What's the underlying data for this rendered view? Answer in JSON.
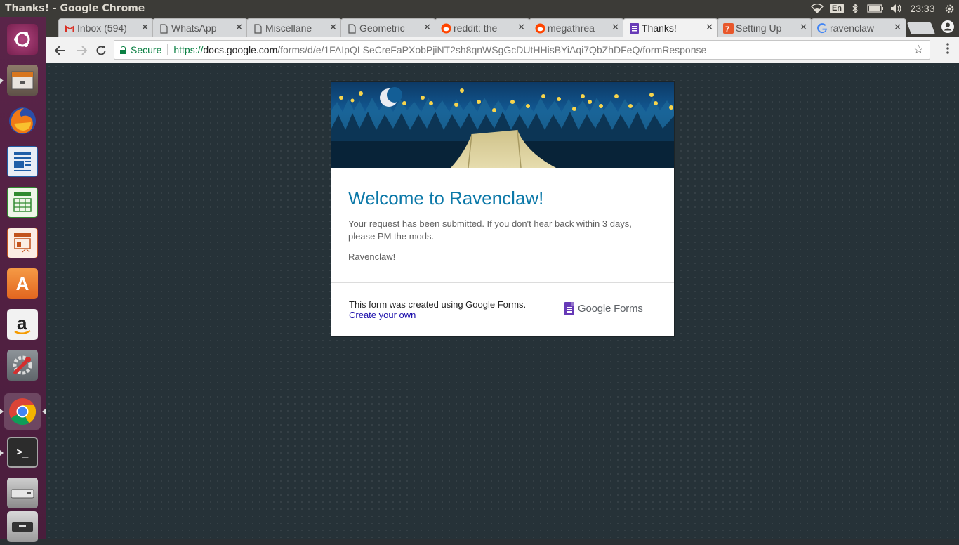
{
  "system": {
    "window_title": "Thanks! - Google Chrome",
    "lang": "En",
    "clock": "23:33"
  },
  "tabs": [
    {
      "label": "Inbox (594)",
      "icon": "gmail-icon"
    },
    {
      "label": "WhatsApp",
      "icon": "page-icon"
    },
    {
      "label": "Miscellane",
      "icon": "page-icon"
    },
    {
      "label": "Geometric",
      "icon": "page-icon"
    },
    {
      "label": "reddit: the",
      "icon": "reddit-icon"
    },
    {
      "label": "megathrea",
      "icon": "reddit-icon"
    },
    {
      "label": "Thanks!",
      "icon": "forms-icon"
    },
    {
      "label": "Setting Up",
      "icon": "site-icon"
    },
    {
      "label": "ravenclaw",
      "icon": "google-icon"
    }
  ],
  "toolbar": {
    "secure_label": "Secure",
    "url_scheme": "https://",
    "url_host": "docs.google.com",
    "url_path": "/forms/d/e/1FAIpQLSeCreFaPXobPjiNT2sh8qnWSgGcDUtHHisBYiAqi7QbZhDFeQ/formResponse"
  },
  "form": {
    "title": "Welcome to Ravenclaw!",
    "message": "Your request has been submitted. If you don't hear back within 3 days, please PM the mods.",
    "message2": "Ravenclaw!",
    "footer_text": "This form was created using Google Forms.",
    "footer_link": "Create your own",
    "brand": "Google Forms"
  },
  "colors": {
    "title": "#0b78a8",
    "launcher": "#5a2449",
    "page_bg": "#263238"
  }
}
